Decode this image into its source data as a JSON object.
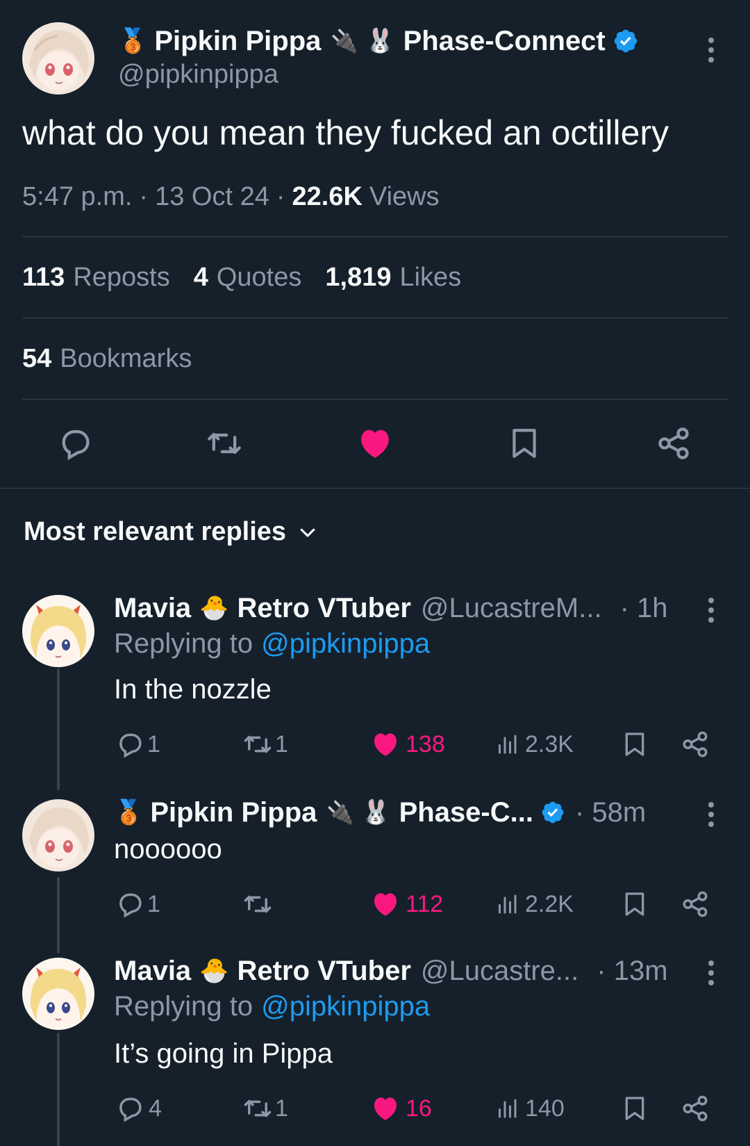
{
  "tweet": {
    "author": {
      "display_name": "Pipkin Pippa",
      "display_suffix": "Phase-Connect",
      "emoji_medal": "🥉",
      "emoji_plug": "🔌",
      "emoji_rabbit": "🐰",
      "handle": "@pipkinpippa",
      "verified": true
    },
    "text": "what do you mean they fucked an octillery",
    "time": "5:47 p.m.",
    "date": "13 Oct 24",
    "views_count": "22.6K",
    "views_label": "Views",
    "stats": {
      "reposts_count": "113",
      "reposts_label": "Reposts",
      "quotes_count": "4",
      "quotes_label": "Quotes",
      "likes_count": "1,819",
      "likes_label": "Likes",
      "bookmarks_count": "54",
      "bookmarks_label": "Bookmarks"
    },
    "liked": true
  },
  "replies_sort": {
    "label": "Most relevant replies"
  },
  "replies": [
    {
      "name": "Mavia",
      "emoji": "🐣",
      "suffix": "Retro VTuber",
      "handle": "@LucastreM...",
      "time": "· 1h",
      "replying_prefix": "Replying to",
      "replying_to": "@pipkinpippa",
      "text": "In the nozzle",
      "replies": "1",
      "reposts": "1",
      "likes": "138",
      "views": "2.3K"
    },
    {
      "name": "Pipkin Pippa",
      "emoji_medal": "🥉",
      "emoji_plug": "🔌",
      "emoji_rabbit": "🐰",
      "suffix": "Phase-C...",
      "time": "· 58m",
      "text": "noooooo",
      "replies": "1",
      "reposts": "",
      "likes": "112",
      "views": "2.2K"
    },
    {
      "name": "Mavia",
      "emoji": "🐣",
      "suffix": "Retro VTuber",
      "handle": "@Lucastre...",
      "time": "· 13m",
      "replying_prefix": "Replying to",
      "replying_to": "@pipkinpippa",
      "text": "It’s going in Pippa",
      "replies": "4",
      "reposts": "1",
      "likes": "16",
      "views": "140"
    }
  ],
  "colors": {
    "background": "#15202b",
    "text": "#f7f9f9",
    "muted": "#8b98a5",
    "accent": "#1d9bf0",
    "like": "#f91880",
    "divider": "#38444d"
  },
  "icons": {
    "reply": "reply-icon",
    "repost": "repost-icon",
    "like": "heart-icon",
    "views": "views-icon",
    "bookmark": "bookmark-icon",
    "share": "share-icon",
    "more": "more-icon",
    "verified": "verified-badge-icon"
  }
}
